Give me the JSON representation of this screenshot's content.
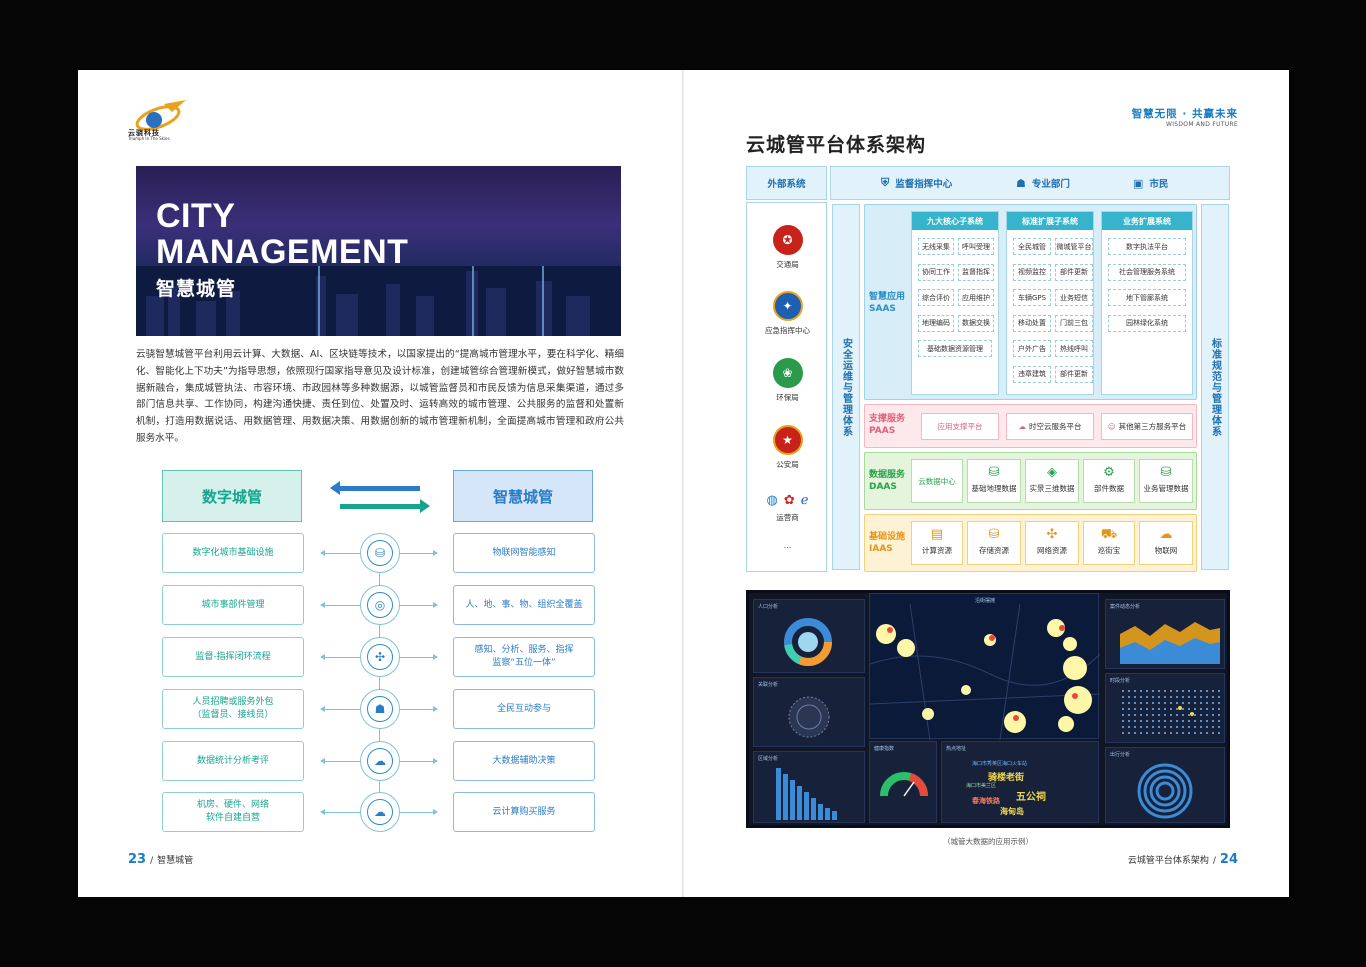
{
  "left_page": {
    "logo": {
      "brand": "云骁科技",
      "tagline": "Triumph In The Skies"
    },
    "hero": {
      "title_line1": "CITY",
      "title_line2": "MANAGEMENT",
      "subtitle": "智慧城管"
    },
    "intro": "云骁智慧城管平台利用云计算、大数据、AI、区块链等技术，以国家提出的“提高城市管理水平，要在科学化、精细化、智能化上下功夫”为指导思想，依照现行国家指导意见及设计标准，创建城管综合管理新模式，做好智慧城市数据新融合，集成城管执法、市容环境、市政园林等多种数据源，以城管监督员和市民反馈为信息采集渠道，通过多部门信息共享、工作协同，构建沟通快捷、责任到位、处置及时、运转高效的城市管理、公共服务的监督和处置新机制，打造用数据说话、用数据管理、用数据决策、用数据创新的城市管理新机制，全面提高城市管理和政府公共服务水平。",
    "compare": {
      "left_title": "数字城管",
      "right_title": "智慧城管",
      "rows": [
        {
          "left": "数字化城市基础设施",
          "right": "物联网智能感知",
          "icon": "⛁"
        },
        {
          "left": "城市事部件管理",
          "right": "人、地、事、物、组织全覆盖",
          "icon": "◎"
        },
        {
          "left": "监督-指挥闭环流程",
          "right": "感知、分析、服务、指挥\n监察“五位一体”",
          "icon": "✣"
        },
        {
          "left": "人员招聘或服务外包\n（监督员、接线员）",
          "right": "全民互动参与",
          "icon": "☗"
        },
        {
          "left": "数据统计分析考评",
          "right": "大数据辅助决策",
          "icon": "☁"
        },
        {
          "left": "机房、硬件、网络\n软件自建自营",
          "right": "云计算购买服务",
          "icon": "☁"
        }
      ]
    },
    "folio": {
      "number": "23",
      "label": "智慧城管"
    }
  },
  "right_page": {
    "slogan": "智慧无限 · 共赢未来",
    "slogan_en": "WISDOM AND FUTURE",
    "title": "云城管平台体系架构",
    "arch": {
      "external_header": "外部系统",
      "top_headers": [
        "监督指挥中心",
        "专业部门",
        "市民"
      ],
      "external": [
        "交通局",
        "应急指挥中心",
        "环保局",
        "公安局",
        "运营商",
        "…"
      ],
      "left_bar": "安全运维与管理体系",
      "right_bar": "标准规范与管理体系",
      "saas": {
        "label": "智慧应用",
        "code": "SAAS",
        "columns": [
          {
            "title": "九大核心子系统",
            "items": [
              "无线采集",
              "呼叫受理",
              "协同工作",
              "监督指挥",
              "综合评价",
              "应用维护",
              "地理编码",
              "数据交换",
              "基础数据资源管理"
            ]
          },
          {
            "title": "标准扩展子系统",
            "items": [
              "全民城管",
              "微城管平台",
              "视频监控",
              "部件更新",
              "车辆GPS",
              "业务短信",
              "移动处置",
              "门前三包",
              "户外广告",
              "热线呼叫",
              "违章建筑",
              "部件更新"
            ]
          },
          {
            "title": "业务扩展系统",
            "items": [
              "数字执法平台",
              "社会管理服务系统",
              "地下管廊系统",
              "园林绿化系统"
            ]
          }
        ]
      },
      "paas": {
        "label": "支撑服务",
        "code": "PAAS",
        "items": [
          "应用支撑平台",
          "时空云服务平台",
          "其他第三方服务平台"
        ]
      },
      "daas": {
        "label": "数据服务",
        "code": "DAAS",
        "items": [
          "云数据中心",
          "基础地理数据",
          "实景三维数据",
          "部件数据",
          "业务管理数据"
        ]
      },
      "iaas": {
        "label": "基础设施",
        "code": "IAAS",
        "items": [
          "计算资源",
          "存储资源",
          "网络资源",
          "巡街宝",
          "物联网"
        ]
      }
    },
    "dashboard": {
      "panels": [
        "人口分析",
        "关联分析",
        "区域分析",
        "沿街摆摊",
        "健康指数",
        "热点地址",
        "案件动态分析",
        "时段分析",
        "出行分析"
      ],
      "wordcloud": [
        "骑楼老街",
        "五公祠",
        "海口市秀英区海口火车站",
        "春海铁路",
        "海口市美兰区",
        "海甸岛"
      ]
    },
    "caption": "（城管大数据的应用示例）",
    "folio": {
      "number": "24",
      "label": "云城管平台体系架构"
    }
  },
  "colors": {
    "teal": "#17a48d",
    "blue": "#2a7cc8",
    "accent": "#1b7cc2"
  }
}
